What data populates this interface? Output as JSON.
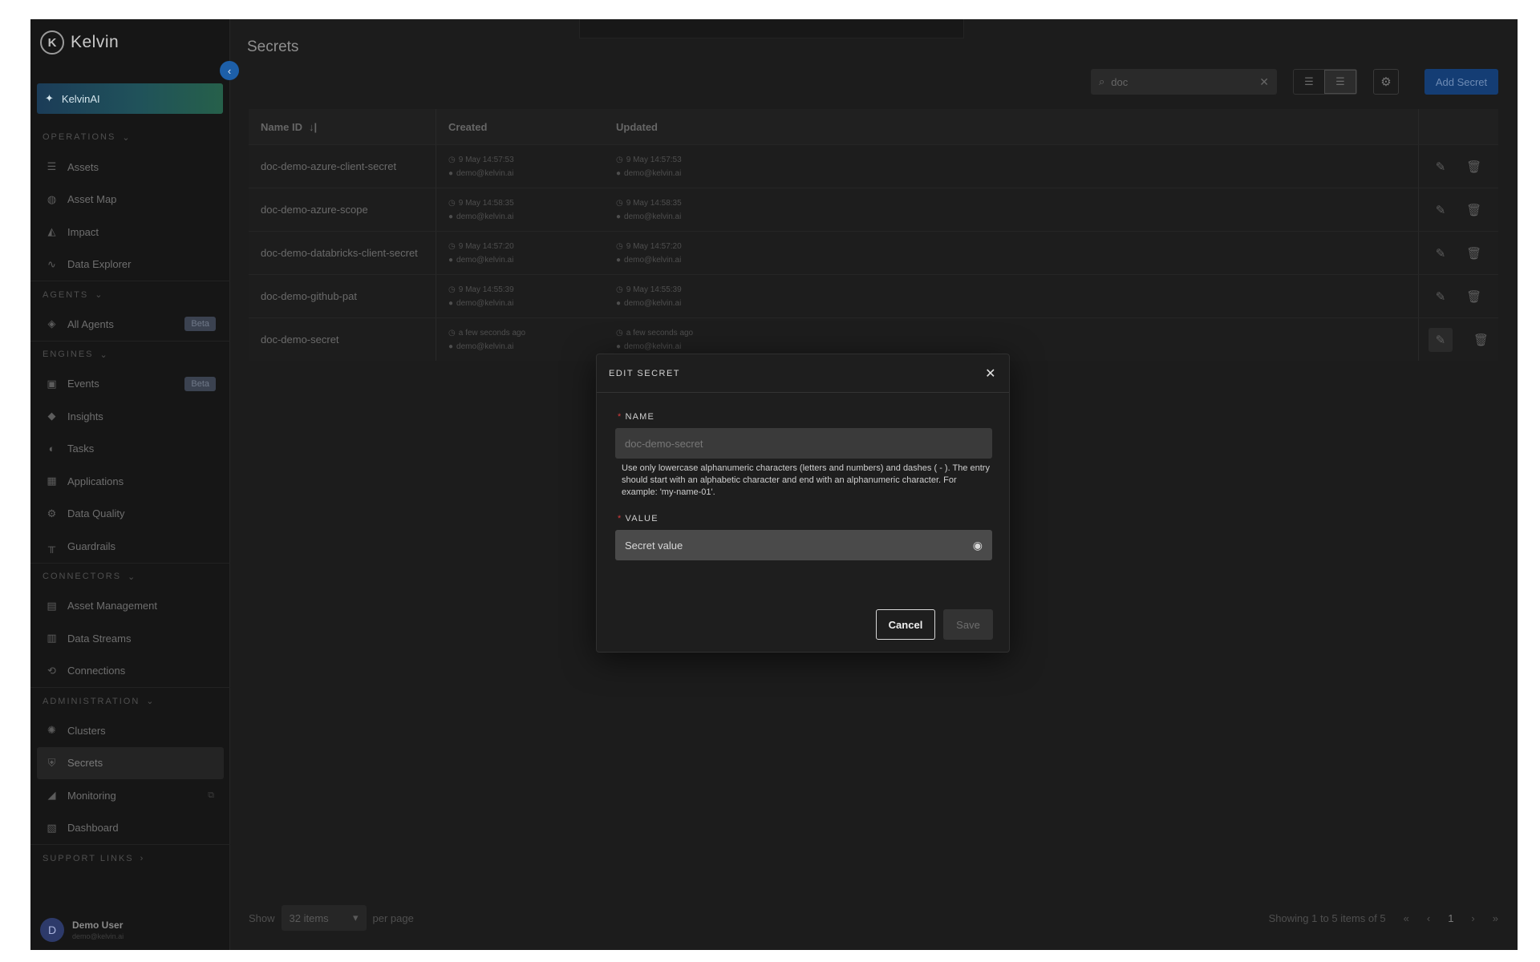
{
  "app": {
    "brand": "Kelvin",
    "kelvinai_label": "KelvinAI"
  },
  "sidebar": {
    "sections": [
      {
        "label": "OPERATIONS",
        "items": [
          {
            "label": "Assets",
            "icon": "stack-icon"
          },
          {
            "label": "Asset Map",
            "icon": "globe-icon"
          },
          {
            "label": "Impact",
            "icon": "chart-area-icon"
          },
          {
            "label": "Data Explorer",
            "icon": "pulse-icon"
          }
        ]
      },
      {
        "label": "AGENTS",
        "items": [
          {
            "label": "All Agents",
            "icon": "compass-icon",
            "badge": "Beta"
          }
        ]
      },
      {
        "label": "ENGINES",
        "items": [
          {
            "label": "Events",
            "icon": "events-icon",
            "badge": "Beta"
          },
          {
            "label": "Insights",
            "icon": "tag-icon"
          },
          {
            "label": "Tasks",
            "icon": "tasks-icon"
          },
          {
            "label": "Applications",
            "icon": "apps-icon"
          },
          {
            "label": "Data Quality",
            "icon": "gear-icon"
          },
          {
            "label": "Guardrails",
            "icon": "barrier-icon"
          }
        ]
      },
      {
        "label": "CONNECTORS",
        "items": [
          {
            "label": "Asset Management",
            "icon": "hierarchy-icon"
          },
          {
            "label": "Data Streams",
            "icon": "streams-icon"
          },
          {
            "label": "Connections",
            "icon": "connection-icon"
          }
        ]
      },
      {
        "label": "ADMINISTRATION",
        "items": [
          {
            "label": "Clusters",
            "icon": "cluster-icon"
          },
          {
            "label": "Secrets",
            "icon": "shield-icon",
            "active": true
          },
          {
            "label": "Monitoring",
            "icon": "monitor-icon",
            "external": true
          },
          {
            "label": "Dashboard",
            "icon": "dashboard-icon"
          }
        ]
      },
      {
        "label": "SUPPORT LINKS",
        "items": []
      }
    ],
    "user": {
      "initial": "D",
      "name": "Demo User",
      "email": "demo@kelvin.ai"
    }
  },
  "page": {
    "title": "Secrets"
  },
  "toolbar": {
    "search_value": "doc",
    "add_label": "Add Secret"
  },
  "table": {
    "headers": {
      "name": "Name ID",
      "sort": "↓|",
      "created": "Created",
      "updated": "Updated"
    },
    "rows": [
      {
        "name": "doc-demo-azure-client-secret",
        "created": "9 May 14:57:53",
        "created_by": "demo@kelvin.ai",
        "updated": "9 May 14:57:53",
        "updated_by": "demo@kelvin.ai"
      },
      {
        "name": "doc-demo-azure-scope",
        "created": "9 May 14:58:35",
        "created_by": "demo@kelvin.ai",
        "updated": "9 May 14:58:35",
        "updated_by": "demo@kelvin.ai"
      },
      {
        "name": "doc-demo-databricks-client-secret",
        "created": "9 May 14:57:20",
        "created_by": "demo@kelvin.ai",
        "updated": "9 May 14:57:20",
        "updated_by": "demo@kelvin.ai"
      },
      {
        "name": "doc-demo-github-pat",
        "created": "9 May 14:55:39",
        "created_by": "demo@kelvin.ai",
        "updated": "9 May 14:55:39",
        "updated_by": "demo@kelvin.ai"
      },
      {
        "name": "doc-demo-secret",
        "created": "a few seconds ago",
        "created_by": "demo@kelvin.ai",
        "updated": "a few seconds ago",
        "updated_by": "demo@kelvin.ai"
      }
    ]
  },
  "pagination": {
    "show": "Show",
    "per_page_value": "32 items",
    "per_page": "per page",
    "summary": "Showing 1 to 5 items of 5",
    "page": "1"
  },
  "modal": {
    "title": "EDIT SECRET",
    "name_label": "NAME",
    "name_value": "doc-demo-secret",
    "help": "Use only lowercase alphanumeric characters (letters and numbers) and dashes ( - ). The entry should start with an alphabetic character and end with an alphanumeric character. For example: 'my-name-01'.",
    "value_label": "VALUE",
    "value_placeholder": "Secret value",
    "cancel": "Cancel",
    "save": "Save"
  }
}
